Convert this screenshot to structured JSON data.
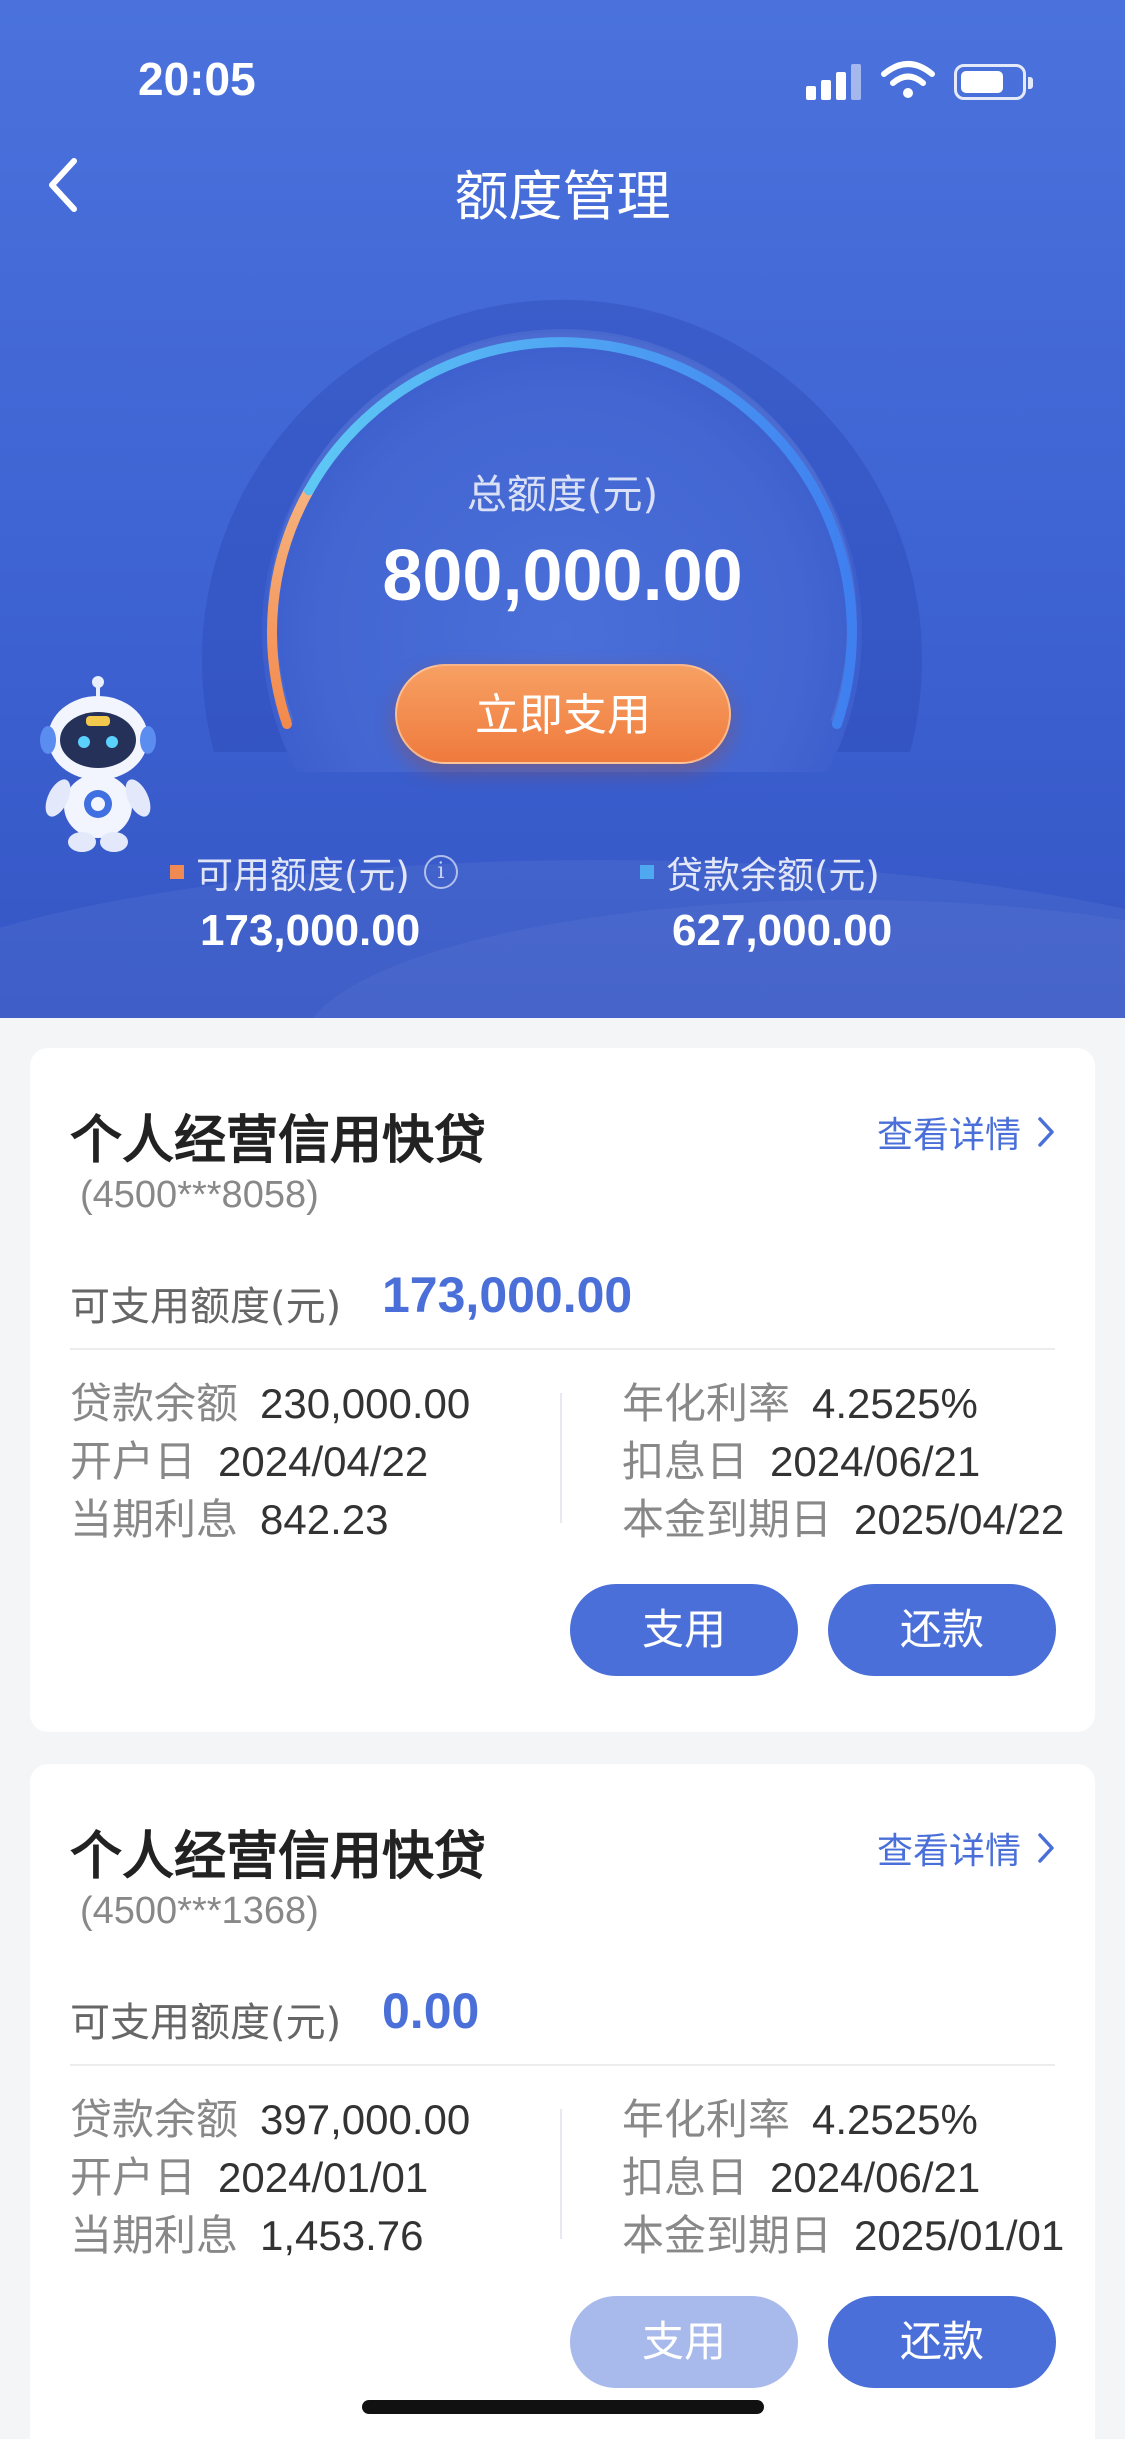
{
  "status_bar": {
    "time": "20:05"
  },
  "header": {
    "title": "额度管理"
  },
  "gauge": {
    "label": "总额度(元)",
    "total": "800,000.00",
    "used_fraction": 0.78,
    "button_label": "立即支用"
  },
  "summary": {
    "available_label": "可用额度(元)",
    "available_value": "173,000.00",
    "loan_label": "贷款余额(元)",
    "loan_value": "627,000.00"
  },
  "colors": {
    "accent": "#4a6fd8",
    "orange": "#ef7a3d",
    "available_marker": "#f08a55",
    "loan_marker": "#4fa8f0"
  },
  "cards": [
    {
      "title": "个人经营信用快贷",
      "account": "(4500***8058)",
      "detail_link": "查看详情",
      "available_label": "可支用额度(元)",
      "available_value": "173,000.00",
      "left": [
        {
          "k": "贷款余额",
          "v": "230,000.00"
        },
        {
          "k": "开户日",
          "v": "2024/04/22"
        },
        {
          "k": "当期利息",
          "v": "842.23"
        }
      ],
      "right": [
        {
          "k": "年化利率",
          "v": "4.2525%"
        },
        {
          "k": "扣息日",
          "v": "2024/06/21"
        },
        {
          "k": "本金到期日",
          "v": "2025/04/22"
        }
      ],
      "use_label": "支用",
      "repay_label": "还款"
    },
    {
      "title": "个人经营信用快贷",
      "account": "(4500***1368)",
      "detail_link": "查看详情",
      "available_label": "可支用额度(元)",
      "available_value": "0.00",
      "left": [
        {
          "k": "贷款余额",
          "v": "397,000.00"
        },
        {
          "k": "开户日",
          "v": "2024/01/01"
        },
        {
          "k": "当期利息",
          "v": "1,453.76"
        }
      ],
      "right": [
        {
          "k": "年化利率",
          "v": "4.2525%"
        },
        {
          "k": "扣息日",
          "v": "2024/06/21"
        },
        {
          "k": "本金到期日",
          "v": "2025/01/01"
        }
      ],
      "use_label": "支用",
      "repay_label": "还款"
    }
  ]
}
